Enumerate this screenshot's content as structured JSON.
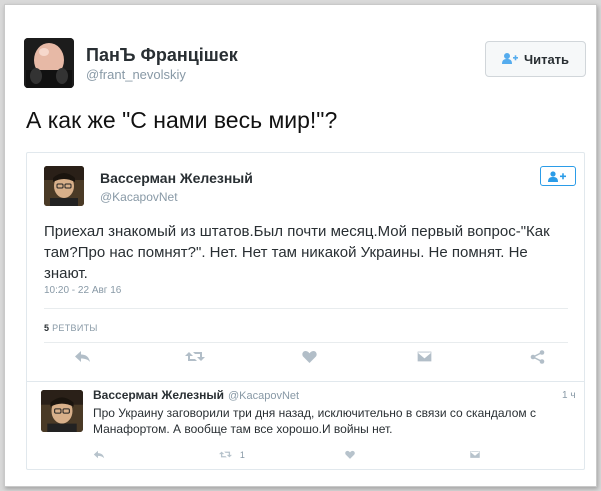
{
  "tweet": {
    "author_name": "ПанЪ Францішек",
    "author_handle": "@frant_nevolskiy",
    "follow_label": "Читать",
    "text": "А как же \"С нами весь мир!\"?"
  },
  "quoted": {
    "author_name": "Вассерман Железный",
    "author_handle": "@KacapovNet",
    "follow_icon": "add-user-icon",
    "text": "Приехал знакомый из штатов.Был почти месяц.Мой первый вопрос-\"Как там?Про нас помнят?\". Нет. Нет там никакой Украины. Не помнят. Не знают.",
    "timestamp": "10:20 - 22 Авг 16",
    "retweet_count": "5",
    "retweet_label": "РЕТВИТЫ",
    "actions": [
      {
        "icon": "reply-icon"
      },
      {
        "icon": "retweet-icon"
      },
      {
        "icon": "like-icon"
      },
      {
        "icon": "direct-message-icon"
      },
      {
        "icon": "share-icon"
      }
    ]
  },
  "reply": {
    "author_name": "Вассерман Железный",
    "author_handle": "@KacapovNet",
    "time": "1 ч",
    "text": "Про Украину заговорили три дня назад, исключительно в связи со скандалом с Манафортом. А вообще там все хорошо.И войны нет.",
    "retweet_count": "1",
    "actions": [
      {
        "icon": "reply-icon"
      },
      {
        "icon": "retweet-icon"
      },
      {
        "icon": "like-icon"
      },
      {
        "icon": "direct-message-icon"
      }
    ]
  },
  "colors": {
    "accent": "#55acee",
    "muted": "#8899a6",
    "text": "#292f33"
  }
}
